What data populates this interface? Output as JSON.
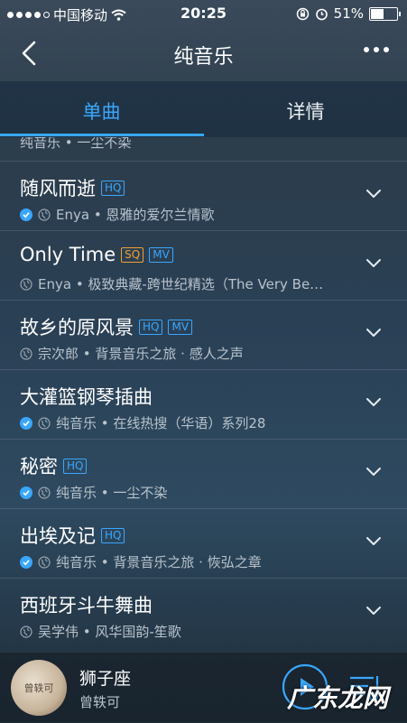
{
  "status": {
    "carrier": "中国移动",
    "time": "20:25",
    "battery": "51%",
    "battery_level": 0.51
  },
  "nav": {
    "title": "纯音乐"
  },
  "tabs": [
    {
      "label": "单曲"
    },
    {
      "label": "详情"
    }
  ],
  "partial_row": {
    "subtitle": "纯音乐 • 一尘不染"
  },
  "songs": [
    {
      "title": "随风而逝",
      "badges": [
        "HQ"
      ],
      "downloaded": true,
      "subtitle": "Enya • 恩雅的爱尔兰情歌"
    },
    {
      "title": "Only Time",
      "badges": [
        "SQ",
        "MV"
      ],
      "downloaded": false,
      "subtitle": "Enya • 极致典藏-跨世纪精选（The Very Be…"
    },
    {
      "title": "故乡的原风景",
      "badges": [
        "HQ",
        "MV"
      ],
      "downloaded": false,
      "subtitle": "宗次郎 • 背景音乐之旅 · 感人之声"
    },
    {
      "title": "大灌篮钢琴插曲",
      "badges": [],
      "downloaded": true,
      "subtitle": "纯音乐 • 在线热搜（华语）系列28"
    },
    {
      "title": "秘密",
      "badges": [
        "HQ"
      ],
      "downloaded": true,
      "subtitle": "纯音乐 • 一尘不染"
    },
    {
      "title": "出埃及记",
      "badges": [
        "HQ"
      ],
      "downloaded": true,
      "subtitle": "纯音乐 • 背景音乐之旅 · 恢弘之章"
    },
    {
      "title": "西班牙斗牛舞曲",
      "badges": [],
      "downloaded": false,
      "subtitle": "吴学伟 • 风华国韵-笙歌"
    }
  ],
  "player": {
    "title": "狮子座",
    "artist": "曾轶可",
    "cover_text": "曾轶可"
  },
  "watermark": "广东龙网",
  "colors": {
    "accent": "#39a7ff",
    "sq": "#f0a030"
  }
}
